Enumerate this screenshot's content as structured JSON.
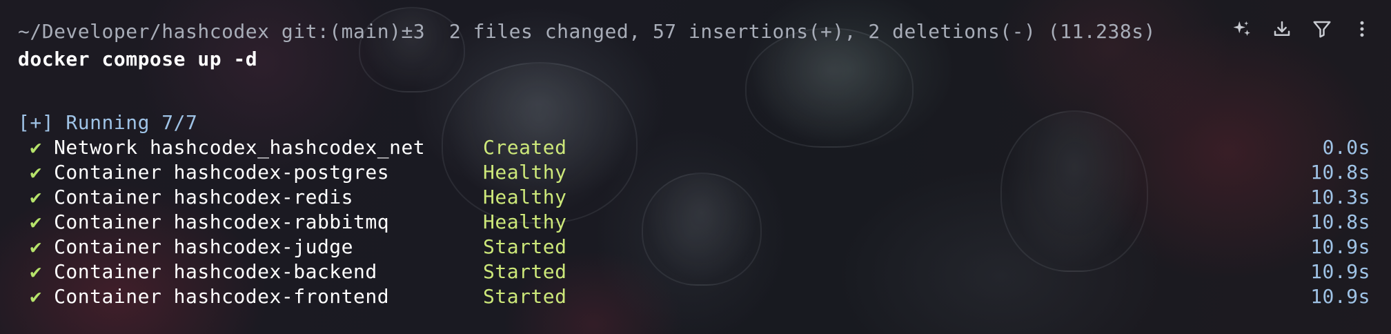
{
  "terminal": {
    "prompt": "~/Developer/hashcodex git:(main)±3  2 files changed, 57 insertions(+), 2 deletions(-) (11.238s)",
    "command": "docker compose up -d",
    "running_status": "[+] Running 7/7",
    "check_glyph": "✔",
    "rows": [
      {
        "resource": "Network hashcodex_hashcodex_net",
        "state": "Created",
        "duration": "0.0s"
      },
      {
        "resource": "Container hashcodex-postgres",
        "state": "Healthy",
        "duration": "10.8s"
      },
      {
        "resource": "Container hashcodex-redis",
        "state": "Healthy",
        "duration": "10.3s"
      },
      {
        "resource": "Container hashcodex-rabbitmq",
        "state": "Healthy",
        "duration": "10.8s"
      },
      {
        "resource": "Container hashcodex-judge",
        "state": "Started",
        "duration": "10.9s"
      },
      {
        "resource": "Container hashcodex-backend",
        "state": "Started",
        "duration": "10.9s"
      },
      {
        "resource": "Container hashcodex-frontend",
        "state": "Started",
        "duration": "10.9s"
      }
    ]
  },
  "toolbar": {
    "icons": [
      "sparkle-icon",
      "download-icon",
      "filter-icon",
      "more-vertical-icon"
    ]
  },
  "colors": {
    "prompt": "#a8adb8",
    "command": "#ffffff",
    "running": "#9fc3e6",
    "check": "#b6e36b",
    "state": "#cde87a",
    "duration": "#9fc3e6"
  }
}
